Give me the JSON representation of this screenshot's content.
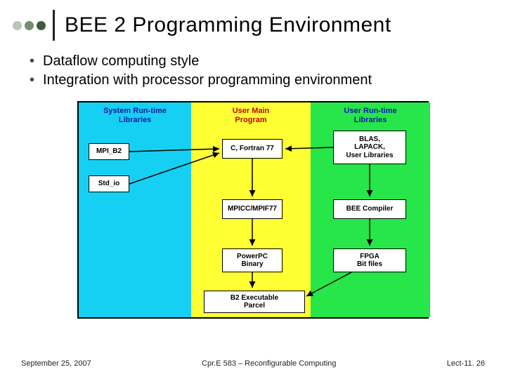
{
  "title": "BEE 2 Programming Environment",
  "bullets": [
    "Dataflow computing style",
    "Integration with processor programming environment"
  ],
  "diagram": {
    "columns": {
      "left": {
        "title1": "System Run-time",
        "title2": "Libraries"
      },
      "mid": {
        "title1": "User Main",
        "title2": "Program"
      },
      "right": {
        "title1": "User Run-time",
        "title2": "Libraries"
      }
    },
    "boxes": {
      "mpi": "MPI_B2",
      "stdio": "Std_io",
      "cfort": "C, Fortran 77",
      "mpicc": "MPICC/MPIF77",
      "ppc": "PowerPC\nBinary",
      "blas": "BLAS,\nLAPACK,\nUser Libraries",
      "beec": "BEE Compiler",
      "fpga": "FPGA\nBit files",
      "exe": "B2 Executable\nParcel"
    }
  },
  "footer": {
    "date": "September 25, 2007",
    "course": "Cpr.E 583 – Reconfigurable Computing",
    "lect": "Lect-11. 26"
  }
}
